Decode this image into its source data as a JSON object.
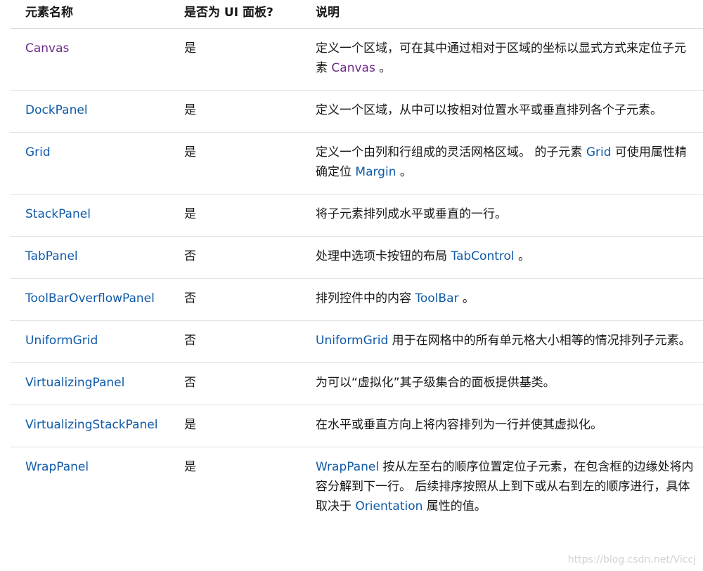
{
  "table": {
    "headers": [
      "元素名称",
      "是否为 UI 面板?",
      "说明"
    ],
    "rows": [
      {
        "name": "Canvas",
        "is_panel": "是",
        "desc": [
          {
            "t": "定义一个区域，可在其中通过相对于区域的坐标以显式方式来定位子元素 "
          },
          {
            "l": "Canvas"
          },
          {
            "t": " 。"
          }
        ]
      },
      {
        "name": "DockPanel",
        "is_panel": "是",
        "desc": [
          {
            "t": "定义一个区域，从中可以按相对位置水平或垂直排列各个子元素。"
          }
        ]
      },
      {
        "name": "Grid",
        "is_panel": "是",
        "desc": [
          {
            "t": "定义一个由列和行组成的灵活网格区域。 的子元素 "
          },
          {
            "l": "Grid"
          },
          {
            "t": " 可使用属性精确定位 "
          },
          {
            "l": "Margin"
          },
          {
            "t": " 。"
          }
        ]
      },
      {
        "name": "StackPanel",
        "is_panel": "是",
        "desc": [
          {
            "t": "将子元素排列成水平或垂直的一行。"
          }
        ]
      },
      {
        "name": "TabPanel",
        "is_panel": "否",
        "desc": [
          {
            "t": "处理中选项卡按钮的布局 "
          },
          {
            "l": "TabControl"
          },
          {
            "t": " 。"
          }
        ]
      },
      {
        "name": "ToolBarOverflowPanel",
        "is_panel": "否",
        "desc": [
          {
            "t": "排列控件中的内容 "
          },
          {
            "l": "ToolBar"
          },
          {
            "t": " 。"
          }
        ]
      },
      {
        "name": "UniformGrid",
        "is_panel": "否",
        "desc": [
          {
            "l": "UniformGrid"
          },
          {
            "t": " 用于在网格中的所有单元格大小相等的情况排列子元素。"
          }
        ]
      },
      {
        "name": "VirtualizingPanel",
        "is_panel": "否",
        "desc": [
          {
            "t": "为可以“虚拟化”其子级集合的面板提供基类。"
          }
        ]
      },
      {
        "name": "VirtualizingStackPanel",
        "is_panel": "是",
        "desc": [
          {
            "t": "在水平或垂直方向上将内容排列为一行并使其虚拟化。"
          }
        ]
      },
      {
        "name": "WrapPanel",
        "is_panel": "是",
        "desc": [
          {
            "l": "WrapPanel"
          },
          {
            "t": " 按从左至右的顺序位置定位子元素，在包含框的边缘处将内容分解到下一行。 后续排序按照从上到下或从右到左的顺序进行，具体取决于 "
          },
          {
            "l": "Orientation"
          },
          {
            "t": " 属性的值。"
          }
        ]
      }
    ]
  },
  "watermark": "https://blog.csdn.net/Viccj",
  "colors": {
    "link": "#0f5aa8",
    "visited_link": "#6c2a8a",
    "text": "#171717",
    "divider": "#e3e3e3"
  }
}
